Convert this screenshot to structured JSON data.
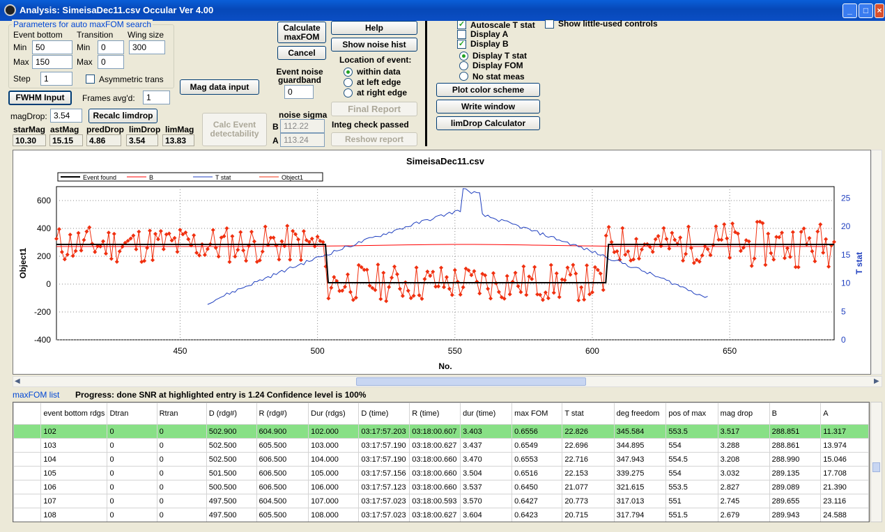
{
  "window": {
    "title": "Analysis: SimeisaDec11.csv  Occular Ver 4.00"
  },
  "params": {
    "group_label": "Parameters for auto maxFOM search",
    "event_bottom": "Event bottom",
    "transition": "Transition",
    "wing_size": "Wing size",
    "min": "Min",
    "max": "Max",
    "step": "Step",
    "eb_min": "50",
    "eb_max": "150",
    "tr_min": "0",
    "tr_max": "0",
    "wing": "300",
    "step_val": "1",
    "asym": "Asymmetric trans"
  },
  "buttons": {
    "calc_maxfom": "Calculate maxFOM",
    "cancel": "Cancel",
    "help": "Help",
    "noise_hist": "Show noise hist",
    "mag_input": "Mag data input",
    "fwhm": "FWHM Input",
    "recalc": "Recalc limdrop",
    "calc_event": "Calc Event detectability",
    "final_report": "Final Report",
    "reshow": "Reshow report",
    "plot_color": "Plot color scheme",
    "write_window": "Write window",
    "limdrop_calc": "limDrop Calculator"
  },
  "frames": {
    "label": "Frames avg'd:",
    "value": "1"
  },
  "magdrop": {
    "label": "magDrop:",
    "value": "3.54"
  },
  "mags": {
    "labels": [
      "starMag",
      "astMag",
      "predDrop",
      "limDrop",
      "limMag"
    ],
    "values": [
      "10.30",
      "15.15",
      "4.86",
      "3.54",
      "13.83"
    ]
  },
  "location": {
    "title": "Location of event:",
    "options": [
      "within data",
      "at left edge",
      "at right edge"
    ]
  },
  "guardband": {
    "label": "Event noise guardband",
    "value": "0"
  },
  "noise": {
    "title": "noise sigma",
    "b_label": "B",
    "b_value": "112.22",
    "a_label": "A",
    "a_value": "113.24"
  },
  "integ": "Integ check passed",
  "checks": {
    "autoscale": "Autoscale T stat",
    "display_a": "Display A",
    "display_b": "Display B",
    "little_used": "Show little-used controls",
    "display_t": "Display T stat",
    "display_fom": "Display FOM",
    "no_stat": "No stat meas"
  },
  "chart_data": {
    "type": "line",
    "title": "SimeisaDec11.csv",
    "xlabel": "No.",
    "ylabel": "Object1",
    "y2label": "T stat",
    "xlim": [
      405,
      688
    ],
    "ylim": [
      -400,
      700
    ],
    "y2lim": [
      0,
      27
    ],
    "xticks": [
      "450",
      "500",
      "550",
      "600",
      "650"
    ],
    "yticks": [
      "600",
      "400",
      "200",
      "0",
      "-200",
      "-400"
    ],
    "y2ticks": [
      "25",
      "20",
      "15",
      "10",
      "5",
      "0"
    ],
    "legend": [
      "Event found",
      "B",
      "T stat",
      "Object1"
    ],
    "colors": {
      "event": "#000000",
      "b": "#ff0000",
      "tstat": "#1f3fbf",
      "object": "#f03010"
    },
    "event": {
      "level_high": 285,
      "level_low": 10,
      "d": 502.9,
      "r": 604.9
    },
    "grid": true
  },
  "list": {
    "label": "maxFOM list",
    "progress": "Progress: done  SNR at highlighted entry is 1.24   Confidence level is  100%",
    "headers": [
      "event bottom rdgs",
      "Dtran",
      "Rtran",
      "D (rdg#)",
      "R (rdg#)",
      "Dur (rdgs)",
      "D (time)",
      "R (time)",
      "dur (time)",
      "max FOM",
      "T stat",
      "deg freedom",
      "pos of max",
      "mag drop",
      "B",
      "A"
    ],
    "rows": [
      [
        "102",
        "0",
        "0",
        "502.900",
        "604.900",
        "102.000",
        "03:17:57.203",
        "03:18:00.607",
        "3.403",
        "0.6556",
        "22.826",
        "345.584",
        "553.5",
        "3.517",
        "288.851",
        "11.317"
      ],
      [
        "103",
        "0",
        "0",
        "502.500",
        "605.500",
        "103.000",
        "03:17:57.190",
        "03:18:00.627",
        "3.437",
        "0.6549",
        "22.696",
        "344.895",
        "554",
        "3.288",
        "288.861",
        "13.974"
      ],
      [
        "104",
        "0",
        "0",
        "502.500",
        "606.500",
        "104.000",
        "03:17:57.190",
        "03:18:00.660",
        "3.470",
        "0.6553",
        "22.716",
        "347.943",
        "554.5",
        "3.208",
        "288.990",
        "15.046"
      ],
      [
        "105",
        "0",
        "0",
        "501.500",
        "606.500",
        "105.000",
        "03:17:57.156",
        "03:18:00.660",
        "3.504",
        "0.6516",
        "22.153",
        "339.275",
        "554",
        "3.032",
        "289.135",
        "17.708"
      ],
      [
        "106",
        "0",
        "0",
        "500.500",
        "606.500",
        "106.000",
        "03:17:57.123",
        "03:18:00.660",
        "3.537",
        "0.6450",
        "21.077",
        "321.615",
        "553.5",
        "2.827",
        "289.089",
        "21.390"
      ],
      [
        "107",
        "0",
        "0",
        "497.500",
        "604.500",
        "107.000",
        "03:17:57.023",
        "03:18:00.593",
        "3.570",
        "0.6427",
        "20.773",
        "317.013",
        "551",
        "2.745",
        "289.655",
        "23.116"
      ],
      [
        "108",
        "0",
        "0",
        "497.500",
        "605.500",
        "108.000",
        "03:17:57.023",
        "03:18:00.627",
        "3.604",
        "0.6423",
        "20.715",
        "317.794",
        "551.5",
        "2.679",
        "289.943",
        "24.588"
      ]
    ]
  }
}
